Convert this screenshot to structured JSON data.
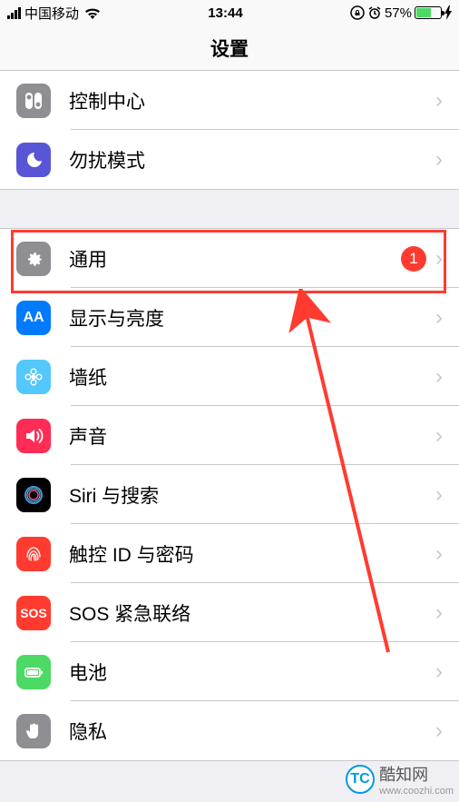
{
  "status": {
    "carrier": "中国移动",
    "time": "13:44",
    "battery_pct": "57%"
  },
  "header": {
    "title": "设置"
  },
  "group1": [
    {
      "label": "控制中心"
    },
    {
      "label": "勿扰模式"
    }
  ],
  "group2": [
    {
      "label": "通用",
      "badge": "1"
    },
    {
      "label": "显示与亮度"
    },
    {
      "label": "墙纸"
    },
    {
      "label": "声音"
    },
    {
      "label": "Siri 与搜索"
    },
    {
      "label": "触控 ID 与密码"
    },
    {
      "label": "SOS 紧急联络"
    },
    {
      "label": "电池"
    },
    {
      "label": "隐私"
    }
  ],
  "sos_text": "SOS",
  "display_text": "AA",
  "watermark": {
    "logo_text": "TC",
    "name": "酷知网",
    "url": "www.coozhi.com"
  }
}
